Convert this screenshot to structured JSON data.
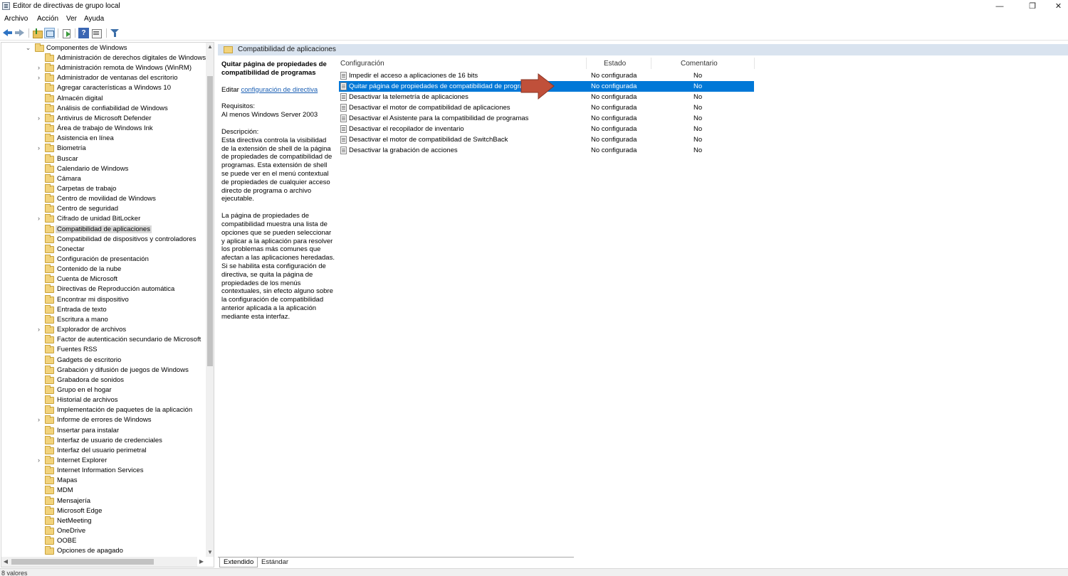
{
  "window": {
    "title": "Editor de directivas de grupo local",
    "minimize": "—",
    "maximize": "❐",
    "close": "✕"
  },
  "menu": [
    "Archivo",
    "Acción",
    "Ver",
    "Ayuda"
  ],
  "toolbar": {
    "icons": [
      "back-arrow-icon",
      "forward-arrow-icon",
      "folder-up-icon",
      "show-hide-console-tree-icon",
      "export-list-icon",
      "help-icon",
      "properties-icon",
      "filter-icon"
    ],
    "help_label": "?"
  },
  "tree": {
    "root": {
      "label": "Componentes de Windows",
      "expander": "⌄"
    },
    "items": [
      {
        "label": "Administración de derechos digitales de Windows",
        "expandable": false
      },
      {
        "label": "Administración remota de Windows (WinRM)",
        "expandable": true
      },
      {
        "label": "Administrador de ventanas del escritorio",
        "expandable": true
      },
      {
        "label": "Agregar características a Windows 10",
        "expandable": false
      },
      {
        "label": "Almacén digital",
        "expandable": false
      },
      {
        "label": "Análisis de confiabilidad de Windows",
        "expandable": false
      },
      {
        "label": "Antivirus de Microsoft Defender",
        "expandable": true
      },
      {
        "label": "Área de trabajo de Windows Ink",
        "expandable": false
      },
      {
        "label": "Asistencia en línea",
        "expandable": false
      },
      {
        "label": "Biometría",
        "expandable": true
      },
      {
        "label": "Buscar",
        "expandable": false
      },
      {
        "label": "Calendario de Windows",
        "expandable": false
      },
      {
        "label": "Cámara",
        "expandable": false
      },
      {
        "label": "Carpetas de trabajo",
        "expandable": false
      },
      {
        "label": "Centro de movilidad de Windows",
        "expandable": false
      },
      {
        "label": "Centro de seguridad",
        "expandable": false
      },
      {
        "label": "Cifrado de unidad BitLocker",
        "expandable": true
      },
      {
        "label": "Compatibilidad de aplicaciones",
        "expandable": false,
        "selected": true
      },
      {
        "label": "Compatibilidad de dispositivos y controladores",
        "expandable": false
      },
      {
        "label": "Conectar",
        "expandable": false
      },
      {
        "label": "Configuración de presentación",
        "expandable": false
      },
      {
        "label": "Contenido de la nube",
        "expandable": false
      },
      {
        "label": "Cuenta de Microsoft",
        "expandable": false
      },
      {
        "label": "Directivas de Reproducción automática",
        "expandable": false
      },
      {
        "label": "Encontrar mi dispositivo",
        "expandable": false
      },
      {
        "label": "Entrada de texto",
        "expandable": false
      },
      {
        "label": "Escritura a mano",
        "expandable": false
      },
      {
        "label": "Explorador de archivos",
        "expandable": true
      },
      {
        "label": "Factor de autenticación secundario de Microsoft",
        "expandable": false
      },
      {
        "label": "Fuentes RSS",
        "expandable": false
      },
      {
        "label": "Gadgets de escritorio",
        "expandable": false
      },
      {
        "label": "Grabación y difusión de juegos de Windows",
        "expandable": false
      },
      {
        "label": "Grabadora de sonidos",
        "expandable": false
      },
      {
        "label": "Grupo en el hogar",
        "expandable": false
      },
      {
        "label": "Historial de archivos",
        "expandable": false
      },
      {
        "label": "Implementación de paquetes de la aplicación",
        "expandable": false
      },
      {
        "label": "Informe de errores de Windows",
        "expandable": true
      },
      {
        "label": "Insertar para instalar",
        "expandable": false
      },
      {
        "label": "Interfaz de usuario de credenciales",
        "expandable": false
      },
      {
        "label": "Interfaz del usuario perimetral",
        "expandable": false
      },
      {
        "label": "Internet Explorer",
        "expandable": true
      },
      {
        "label": "Internet Information Services",
        "expandable": false
      },
      {
        "label": "Mapas",
        "expandable": false
      },
      {
        "label": "MDM",
        "expandable": false
      },
      {
        "label": "Mensajería",
        "expandable": false
      },
      {
        "label": "Microsoft Edge",
        "expandable": false
      },
      {
        "label": "NetMeeting",
        "expandable": false
      },
      {
        "label": "OneDrive",
        "expandable": false
      },
      {
        "label": "OOBE",
        "expandable": false
      },
      {
        "label": "Opciones de apagado",
        "expandable": false
      }
    ],
    "expander_closed": "›",
    "scroll_up": "▲",
    "scroll_down": "▼",
    "scroll_left": "◀",
    "scroll_right": "▶"
  },
  "right_pane": {
    "header": "Compatibilidad de aplicaciones",
    "description": {
      "title": "Quitar página de propiedades de compatibilidad de programas",
      "edit_prefix": "Editar ",
      "edit_link": "configuración de directiva",
      "requirements_label": "Requisitos:",
      "requirements_value": "Al menos Windows Server 2003",
      "description_label": "Descripción:",
      "paragraph1": "Esta directiva controla la visibilidad de la extensión de shell de la página de propiedades de compatibilidad de programas.  Esta extensión de shell se puede ver en el menú contextual de propiedades de cualquier acceso directo de programa o archivo ejecutable.",
      "paragraph2": "La página de propiedades de compatibilidad muestra una lista de opciones que se pueden seleccionar y aplicar a la aplicación para resolver los problemas más comunes que afectan a las aplicaciones heredadas. Si se habilita esta configuración de directiva, se quita la página de propiedades de los menús contextuales, sin efecto alguno sobre la configuración de compatibilidad anterior aplicada a la aplicación mediante esta interfaz."
    },
    "columns": {
      "setting": "Configuración",
      "state": "Estado",
      "comment": "Comentario"
    },
    "policies": [
      {
        "name": "Impedir el acceso a aplicaciones de 16 bits",
        "state": "No configurada",
        "comment": "No",
        "selected": false
      },
      {
        "name": "Quitar página de propiedades de compatibilidad de programas",
        "state": "No configurada",
        "comment": "No",
        "selected": true
      },
      {
        "name": "Desactivar la telemetría de aplicaciones",
        "state": "No configurada",
        "comment": "No",
        "selected": false
      },
      {
        "name": "Desactivar el motor de compatibilidad de aplicaciones",
        "state": "No configurada",
        "comment": "No",
        "selected": false
      },
      {
        "name": "Desactivar el Asistente para la compatibilidad de programas",
        "state": "No configurada",
        "comment": "No",
        "selected": false
      },
      {
        "name": "Desactivar el recopilador de inventario",
        "state": "No configurada",
        "comment": "No",
        "selected": false
      },
      {
        "name": "Desactivar el motor de compatibilidad de SwitchBack",
        "state": "No configurada",
        "comment": "No",
        "selected": false
      },
      {
        "name": "Desactivar la grabación de acciones",
        "state": "No configurada",
        "comment": "No",
        "selected": false
      }
    ],
    "callout_color": "#c0503a",
    "selection_color": "#0078d7"
  },
  "tabs": {
    "extended": "Extendido",
    "standard": "Estándar"
  },
  "status": "8 valores"
}
